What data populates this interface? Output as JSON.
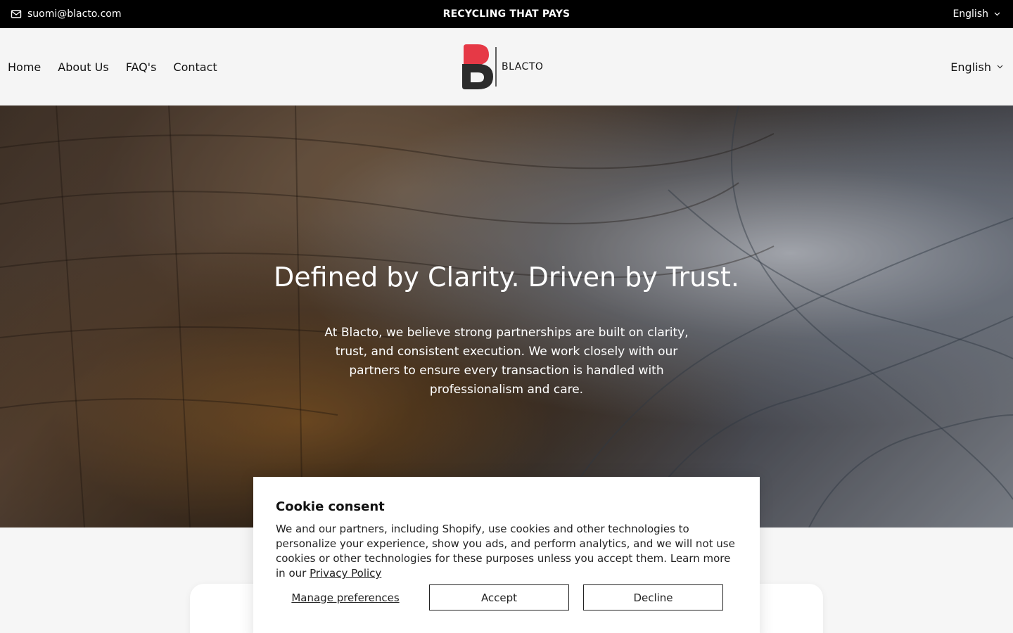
{
  "topbar": {
    "email": "suomi@blacto.com",
    "announcement": "RECYCLING THAT PAYS",
    "language": "English"
  },
  "header": {
    "nav": [
      "Home",
      "About Us",
      "FAQ's",
      "Contact"
    ],
    "logo_text": "BLACTO",
    "language": "English"
  },
  "hero": {
    "title": "Defined by Clarity. Driven by Trust.",
    "body": "At Blacto, we believe strong partnerships are built on clarity, trust, and consistent execution. We work closely with our partners to ensure every transaction is handled with professionalism and care."
  },
  "cookie": {
    "title": "Cookie consent",
    "text": "We and our partners, including Shopify, use cookies and other technologies to personalize your experience, show you ads, and perform analytics, and we will not use cookies or other technologies for these purposes unless you accept them. Learn more in our ",
    "privacy_link": "Privacy Policy",
    "manage_label": "Manage preferences",
    "accept_label": "Accept",
    "decline_label": "Decline"
  },
  "icons": {
    "mail": "mail-icon",
    "chevron": "chevron-down-icon"
  },
  "colors": {
    "topbar_bg": "#000000",
    "logo_red": "#e63946",
    "logo_dark": "#2b2b2b"
  }
}
